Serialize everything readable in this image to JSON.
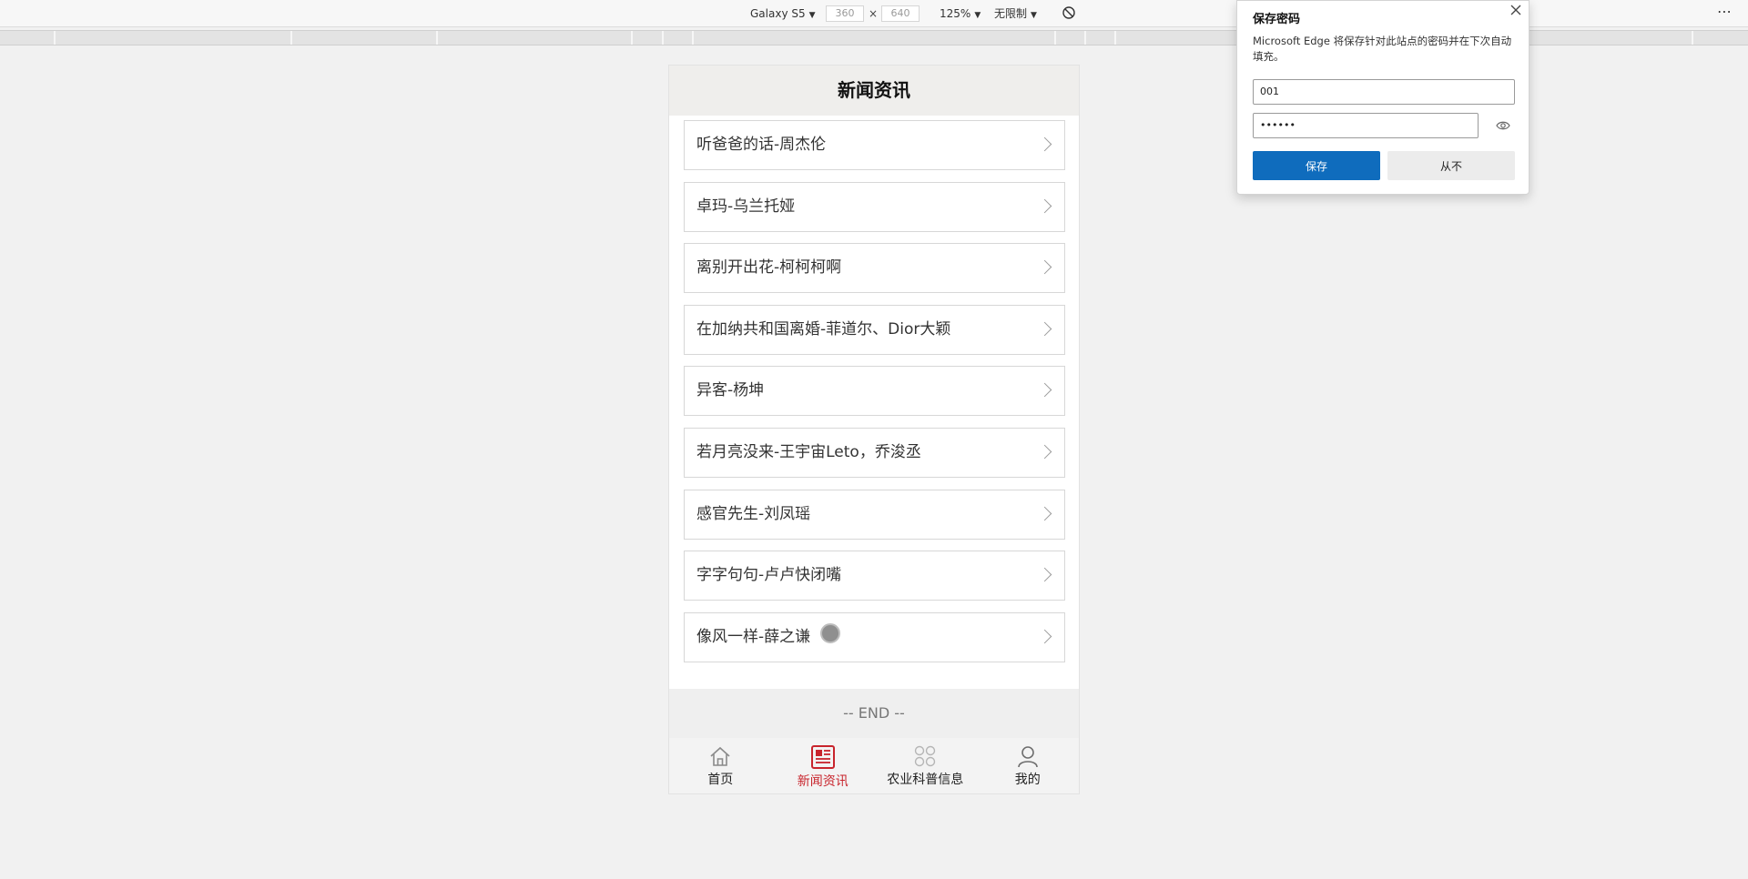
{
  "devtools": {
    "device": "Galaxy S5",
    "width": "360",
    "height": "640",
    "times": "×",
    "zoom": "125%",
    "throttle": "无限制",
    "more": "⋯"
  },
  "page": {
    "title": "新闻资讯",
    "news_items": [
      "听爸爸的话-周杰伦",
      "卓玛-乌兰托娅",
      "离别开出花-柯柯柯啊",
      "在加纳共和国离婚-菲道尔、Dior大颖",
      "异客-杨坤",
      "若月亮没来-王宇宙Leto，乔浚丞",
      "感官先生-刘凤瑶",
      "字字句句-卢卢快闭嘴",
      "像风一样-薛之谦"
    ],
    "end_text": "-- END --",
    "tabs": [
      {
        "label": "首页",
        "icon": "home-icon"
      },
      {
        "label": "新闻资讯",
        "icon": "news-icon"
      },
      {
        "label": "农业科普信息",
        "icon": "grid-icon"
      },
      {
        "label": "我的",
        "icon": "user-icon"
      }
    ],
    "accent_color": "#c8242c"
  },
  "password_popup": {
    "title": "保存密码",
    "description": "Microsoft Edge 将保存针对此站点的密码并在下次自动填充。",
    "username": "001",
    "password": "••••••",
    "save_label": "保存",
    "never_label": "从不",
    "save_color": "#0f6cbd"
  }
}
